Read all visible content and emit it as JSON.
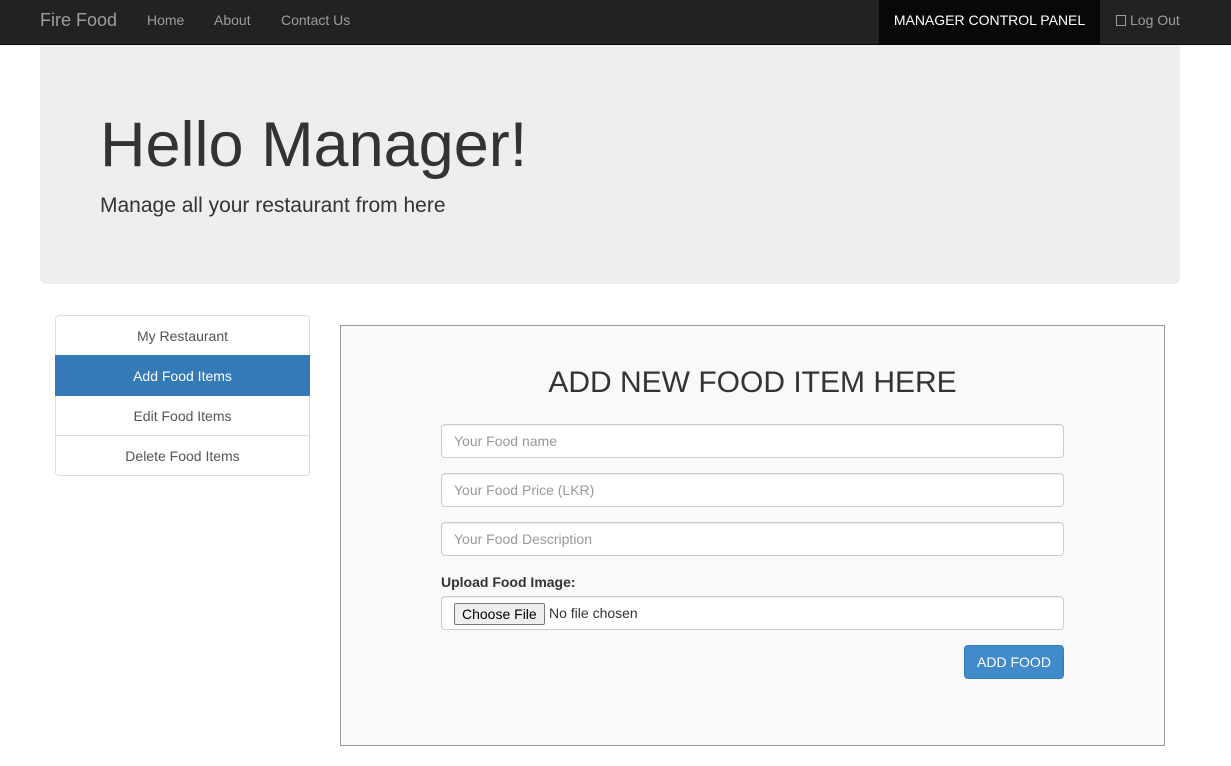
{
  "navbar": {
    "brand": "Fire Food",
    "links": [
      "Home",
      "About",
      "Contact Us"
    ],
    "control_panel": "MANAGER CONTROL PANEL",
    "logout": "Log Out",
    "logout_icon": "logout-icon"
  },
  "jumbotron": {
    "title": "Hello Manager!",
    "subtitle": "Manage all your restaurant from here"
  },
  "sidebar": {
    "items": [
      {
        "label": "My Restaurant",
        "active": false
      },
      {
        "label": "Add Food Items",
        "active": true
      },
      {
        "label": "Edit Food Items",
        "active": false
      },
      {
        "label": "Delete Food Items",
        "active": false
      }
    ]
  },
  "form": {
    "heading": "ADD NEW FOOD ITEM HERE",
    "name_placeholder": "Your Food name",
    "price_placeholder": "Your Food Price (LKR)",
    "description_placeholder": "Your Food Description",
    "upload_label": "Upload Food Image:",
    "file_button": "Choose File",
    "file_status": "No file chosen",
    "submit": "ADD FOOD"
  },
  "colors": {
    "navbar_bg": "#222222",
    "active_panel_bg": "#080808",
    "jumbotron_bg": "#eeeeee",
    "active_item": "#337ab7",
    "submit_button": "#428bca"
  }
}
